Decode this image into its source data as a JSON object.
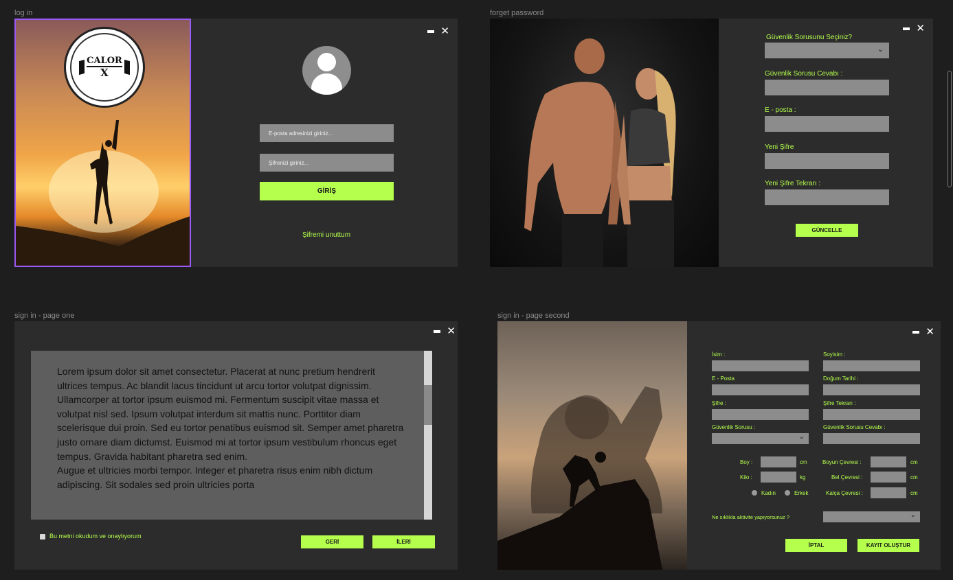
{
  "frames": {
    "login": {
      "label": "log in",
      "logo_text_top": "CALOR",
      "logo_text_bottom": "X",
      "email_placeholder": "E-posta adresinizi giriniz...",
      "password_placeholder": "Şifrenizi giriniz...",
      "login_button": "GİRİŞ",
      "forgot_link": "Şifremi unuttum"
    },
    "forget": {
      "label": "forget password",
      "security_question_label": "Güvenlik Sorusunu Seçiniz?",
      "security_answer_label": "Güvenlik Sorusu Cevabı :",
      "email_label": "E - posta :",
      "new_password_label": "Yeni Şifre",
      "new_password_repeat_label": "Yeni Şifre Tekrarı :",
      "update_button": "GÜNCELLE"
    },
    "signup1": {
      "label": "sign in - page one",
      "terms_text_1": "Lorem ipsum dolor sit amet consectetur. Placerat at nunc pretium hendrerit ultrices tempus. Ac blandit lacus tincidunt ut arcu tortor volutpat dignissim. Ullamcorper at tortor ipsum euismod mi. Fermentum suscipit vitae massa et volutpat nisl sed. Ipsum volutpat interdum sit mattis nunc. Porttitor diam scelerisque dui proin. Sed eu tortor penatibus euismod sit. Semper amet pharetra justo ornare diam dictumst. Euismod mi at tortor ipsum vestibulum rhoncus eget tempus. Gravida habitant pharetra sed enim.",
      "terms_text_2": "Augue et ultricies morbi tempor. Integer et pharetra risus enim nibh dictum adipiscing. Sit sodales sed proin ultricies porta",
      "agree_label": "Bu metni okudum ve onaylıyorum",
      "back_button": "GERİ",
      "next_button": "İLERİ"
    },
    "signup2": {
      "label": "sign in - page second",
      "name_label": "İsim :",
      "surname_label": "Soyisim :",
      "email_label": "E - Posta",
      "birthdate_label": "Doğum Tarihi :",
      "password_label": "Şifre :",
      "password_repeat_label": "Şifre Tekrarı :",
      "security_question_label": "Güvenlik Sorusu :",
      "security_answer_label": "Güvenlik Sorusu Cevabı :",
      "height_label": "Boy :",
      "height_unit": "cm",
      "weight_label": "Kilo :",
      "weight_unit": "kg",
      "neck_label": "Boyun Çevresi :",
      "neck_unit": "cm",
      "waist_label": "Bel Çevresi :",
      "waist_unit": "cm",
      "hip_label": "Kalça Çevresi :",
      "hip_unit": "cm",
      "gender_female": "Kadın",
      "gender_male": "Erkek",
      "activity_label": "Ne sıklıkla aktivite yapıyorsunuz ?",
      "cancel_button": "İPTAL",
      "create_button": "KAYIT OLUŞTUR"
    }
  },
  "colors": {
    "accent": "#b5ff4d",
    "panel": "#2c2c2c",
    "field": "#8c8c8c",
    "selection": "#9b59f5"
  }
}
